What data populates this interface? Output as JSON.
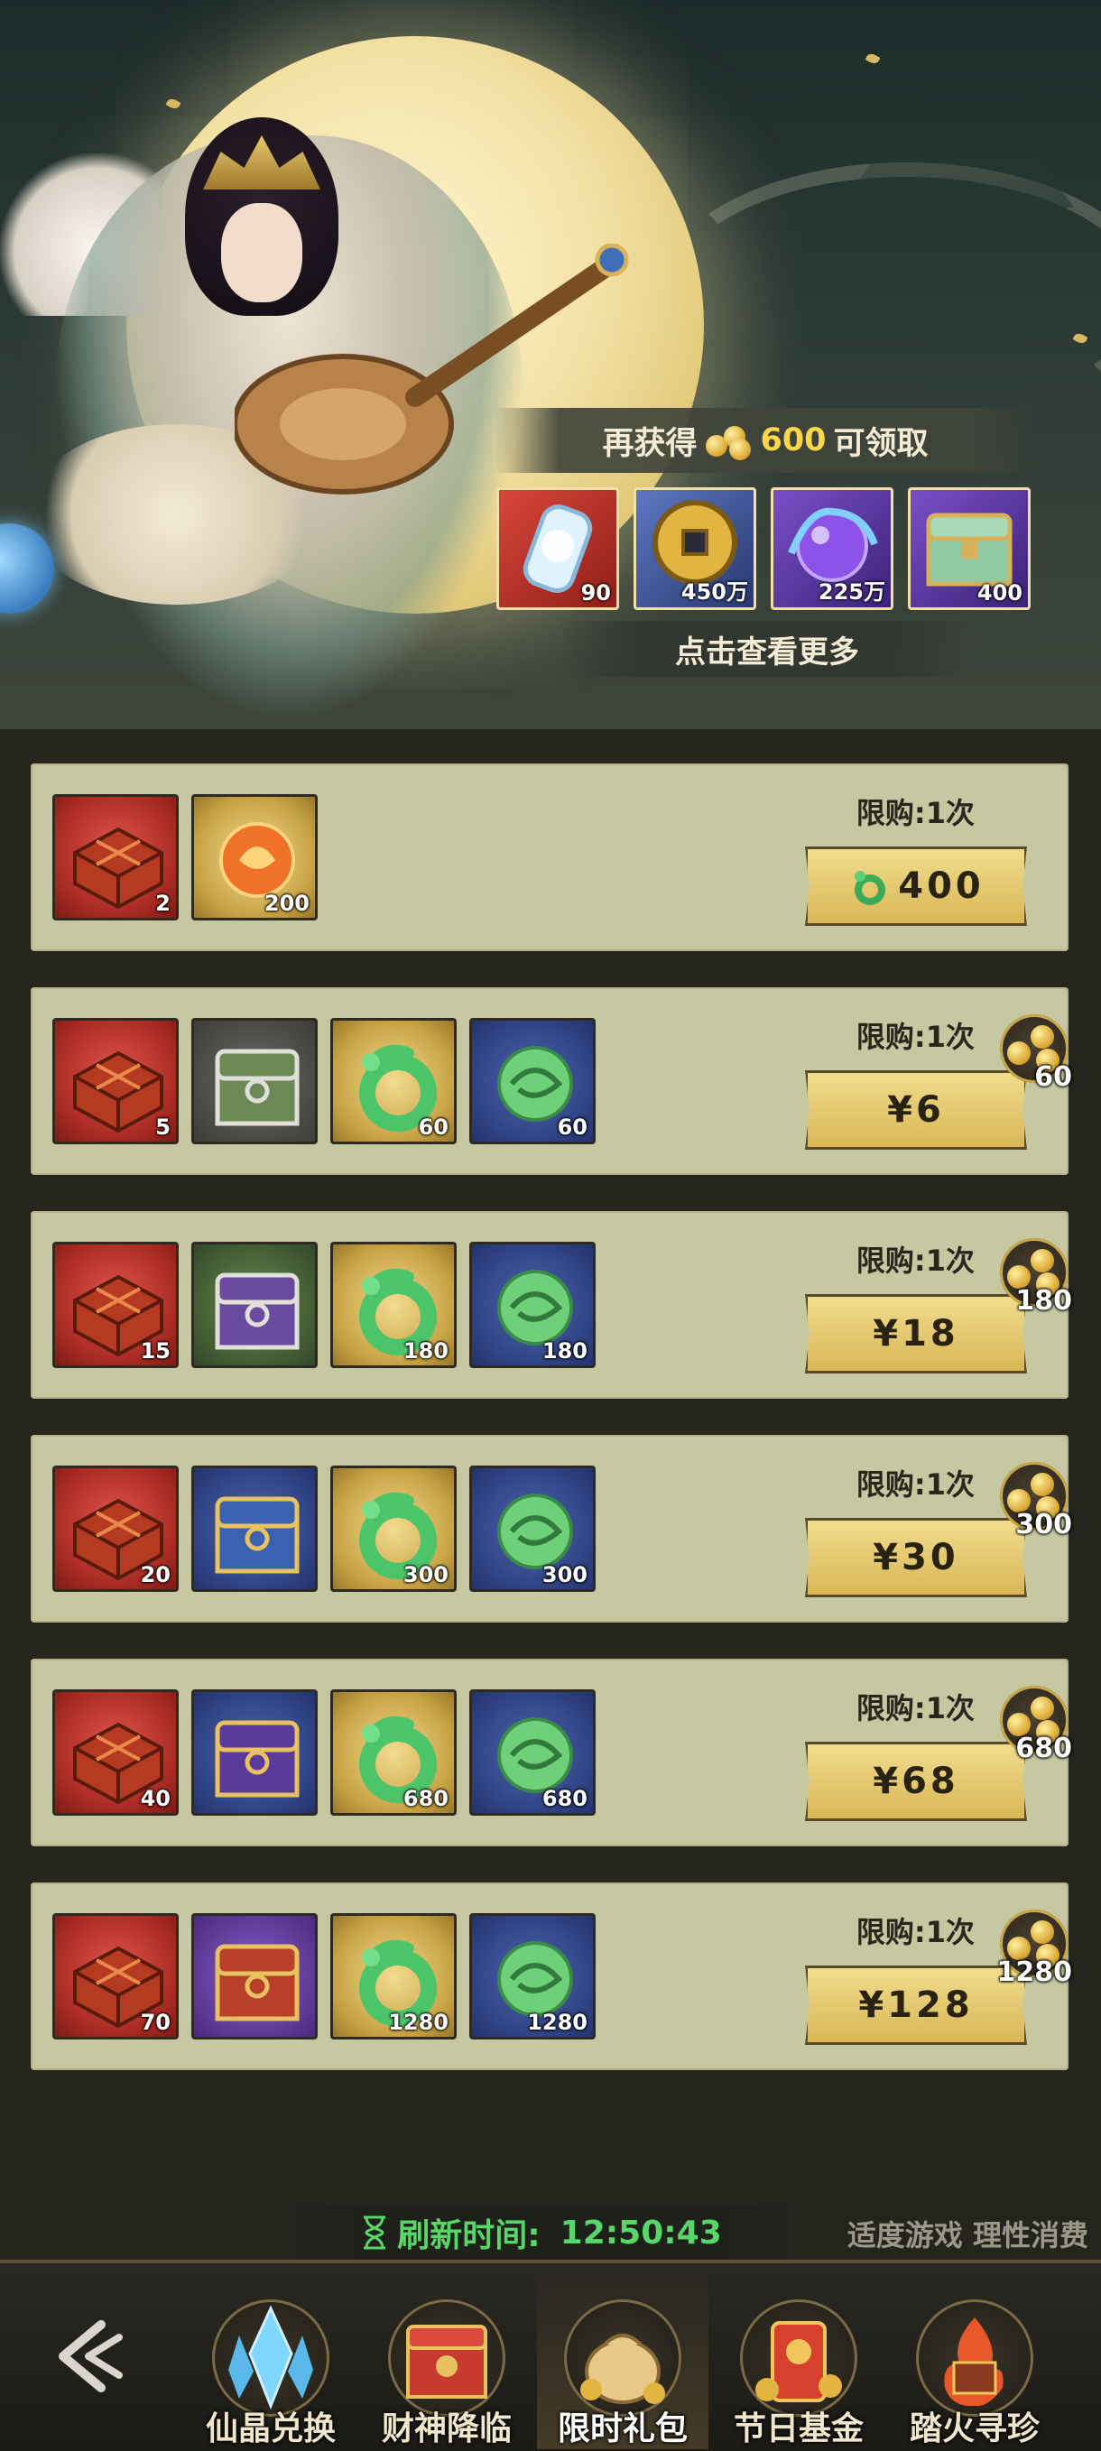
{
  "banner": {
    "progress_prefix": "再获得",
    "progress_amount": "600",
    "progress_suffix": "可领取",
    "rewards": [
      {
        "icon": "lantern-icon",
        "count": "90"
      },
      {
        "icon": "copper-coin-icon",
        "count": "450万"
      },
      {
        "icon": "purple-orb-icon",
        "count": "225万"
      },
      {
        "icon": "treasure-chest-icon",
        "count": "400"
      }
    ],
    "view_more": "点击查看更多"
  },
  "packs": [
    {
      "limit": "限购:1次",
      "price": "400",
      "price_icon": "jade-dragon-icon",
      "bonus": null,
      "items": [
        {
          "icon": "red-crate-icon",
          "slot": "red",
          "count": "2"
        },
        {
          "icon": "fire-orb-icon",
          "slot": "gold",
          "count": "200"
        }
      ]
    },
    {
      "limit": "限购:1次",
      "price": "¥6",
      "bonus": "60",
      "items": [
        {
          "icon": "red-crate-icon",
          "slot": "red",
          "count": "5"
        },
        {
          "icon": "green-chest-icon",
          "slot": "gray",
          "count": ""
        },
        {
          "icon": "jade-dragon-icon",
          "slot": "gold",
          "count": "60"
        },
        {
          "icon": "jade-orb-icon",
          "slot": "blue",
          "count": "60"
        }
      ]
    },
    {
      "limit": "限购:1次",
      "price": "¥18",
      "bonus": "180",
      "items": [
        {
          "icon": "red-crate-icon",
          "slot": "red",
          "count": "15"
        },
        {
          "icon": "purple-chest-icon",
          "slot": "green",
          "count": ""
        },
        {
          "icon": "jade-dragon-icon",
          "slot": "gold",
          "count": "180"
        },
        {
          "icon": "jade-orb-icon",
          "slot": "blue",
          "count": "180"
        }
      ]
    },
    {
      "limit": "限购:1次",
      "price": "¥30",
      "bonus": "300",
      "items": [
        {
          "icon": "red-crate-icon",
          "slot": "red",
          "count": "20"
        },
        {
          "icon": "blue-gold-chest-icon",
          "slot": "blue",
          "count": ""
        },
        {
          "icon": "jade-dragon-icon",
          "slot": "gold",
          "count": "300"
        },
        {
          "icon": "jade-orb-icon",
          "slot": "blue",
          "count": "300"
        }
      ]
    },
    {
      "limit": "限购:1次",
      "price": "¥68",
      "bonus": "680",
      "items": [
        {
          "icon": "red-crate-icon",
          "slot": "red",
          "count": "40"
        },
        {
          "icon": "purple-gold-chest-icon",
          "slot": "blue",
          "count": ""
        },
        {
          "icon": "jade-dragon-icon",
          "slot": "gold",
          "count": "680"
        },
        {
          "icon": "jade-orb-icon",
          "slot": "blue",
          "count": "680"
        }
      ]
    },
    {
      "limit": "限购:1次",
      "price": "¥128",
      "bonus": "1280",
      "items": [
        {
          "icon": "red-crate-icon",
          "slot": "red",
          "count": "70"
        },
        {
          "icon": "red-gold-chest-icon",
          "slot": "purple",
          "count": ""
        },
        {
          "icon": "jade-dragon-icon",
          "slot": "gold",
          "count": "1280"
        },
        {
          "icon": "jade-orb-icon",
          "slot": "blue",
          "count": "1280"
        }
      ]
    }
  ],
  "refresh": {
    "label": "刷新时间:",
    "time": "12:50:43"
  },
  "notice": "适度游戏 理性消费",
  "nav": {
    "tabs": [
      {
        "label": "仙晶兑换",
        "icon": "crystal-icon"
      },
      {
        "label": "财神降临",
        "icon": "god-of-wealth-chest-icon"
      },
      {
        "label": "限时礼包",
        "icon": "gift-bag-icon",
        "active": true
      },
      {
        "label": "节日基金",
        "icon": "festival-fund-icon"
      },
      {
        "label": "踏火寻珍",
        "icon": "fire-treasure-icon"
      }
    ]
  },
  "colors": {
    "card_bg": "#c6c8a2",
    "accent_gold": "#ffd64a",
    "refresh_green": "#58d66a",
    "price_gold": "#e6c66e"
  }
}
